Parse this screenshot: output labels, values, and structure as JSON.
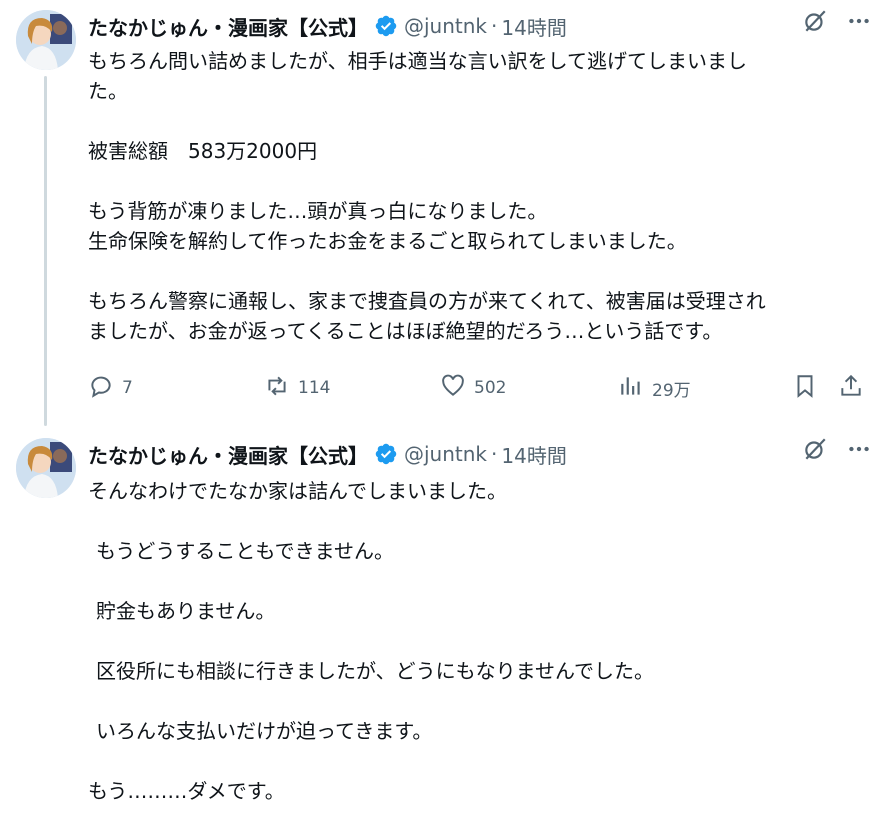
{
  "tweets": [
    {
      "author_name": "たなかじゅん・漫画家【公式】",
      "handle": "@juntnk",
      "time_sep": "·",
      "time": "14時間",
      "lines": [
        "もちろん問い詰めましたが、相手は適当な言い訳をして逃げてしまいまし",
        "た。",
        "",
        "被害総額　583万2000円",
        "",
        "もう背筋が凍りました…頭が真っ白になりました。",
        "生命保険を解約して作ったお金をまるごと取られてしまいました。",
        "",
        "もちろん警察に通報し、家まで捜査員の方が来てくれて、被害届は受理され",
        "ましたが、お金が返ってくることはほぼ絶望的だろう…という話です。"
      ],
      "actions": {
        "replies": "7",
        "retweets": "114",
        "likes": "502",
        "views": "29万"
      }
    },
    {
      "author_name": "たなかじゅん・漫画家【公式】",
      "handle": "@juntnk",
      "time_sep": "·",
      "time": "14時間",
      "lines": [
        "そんなわけでたなか家は詰んでしまいました。",
        "",
        "もうどうすることもできません。",
        "",
        "貯金もありません。",
        "",
        "区役所にも相談に行きましたが、どうにもなりませんでした。",
        "",
        "いろんな支払いだけが迫ってきます。",
        "",
        "もう………ダメです。"
      ]
    }
  ],
  "icons": {
    "verified": "verified-badge-icon",
    "grok": "grok-icon",
    "more": "more-icon",
    "reply": "reply-icon",
    "retweet": "retweet-icon",
    "like": "like-icon",
    "views": "views-icon",
    "bookmark": "bookmark-icon",
    "share": "share-icon"
  },
  "colors": {
    "verified": "#1d9bf0",
    "muted": "#536471",
    "text": "#0f1419",
    "thread_line": "#cfd9de"
  }
}
